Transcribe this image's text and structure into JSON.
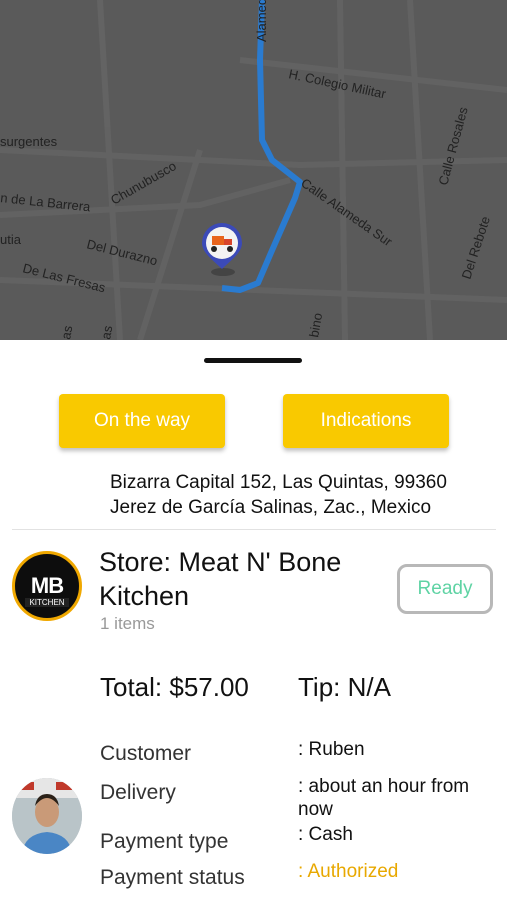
{
  "map": {
    "streets": [
      "Alameda",
      "H. Colegio Militar",
      "surgentes",
      "Calle Rosales",
      "Chunubusco",
      "n de La Barrera",
      "Calle Alameda Sur",
      "utia",
      "Del Durazno",
      "Del Rebote",
      "De Las Fresas",
      "bino",
      "as",
      "as"
    ],
    "route_color": "#2a7bd0",
    "marker_icon": "delivery-scooter-icon"
  },
  "buttons": {
    "on_the_way": "On the way",
    "indications": "Indications"
  },
  "address": {
    "line1": "Bizarra Capital 152, Las Quintas, 99360",
    "line2": "Jerez de García Salinas, Zac., Mexico"
  },
  "store": {
    "name": "Store: Meat N' Bone Kitchen",
    "items": "1 items",
    "status": "Ready",
    "logo_text": "MB",
    "logo_sub": "KITCHEN"
  },
  "order": {
    "total": "Total: $57.00",
    "tip": "Tip: N/A"
  },
  "details": {
    "customer_label": "Customer",
    "customer_value": ": Ruben",
    "delivery_label": "Delivery",
    "delivery_value": ": about an hour from now",
    "payment_type_label": "Payment type",
    "payment_type_value": ": Cash",
    "payment_status_label": "Payment status",
    "payment_status_value": ": Authorized"
  },
  "colors": {
    "accent": "#f9c900",
    "ready": "#5fd3a4",
    "authorized": "#e8a800"
  }
}
